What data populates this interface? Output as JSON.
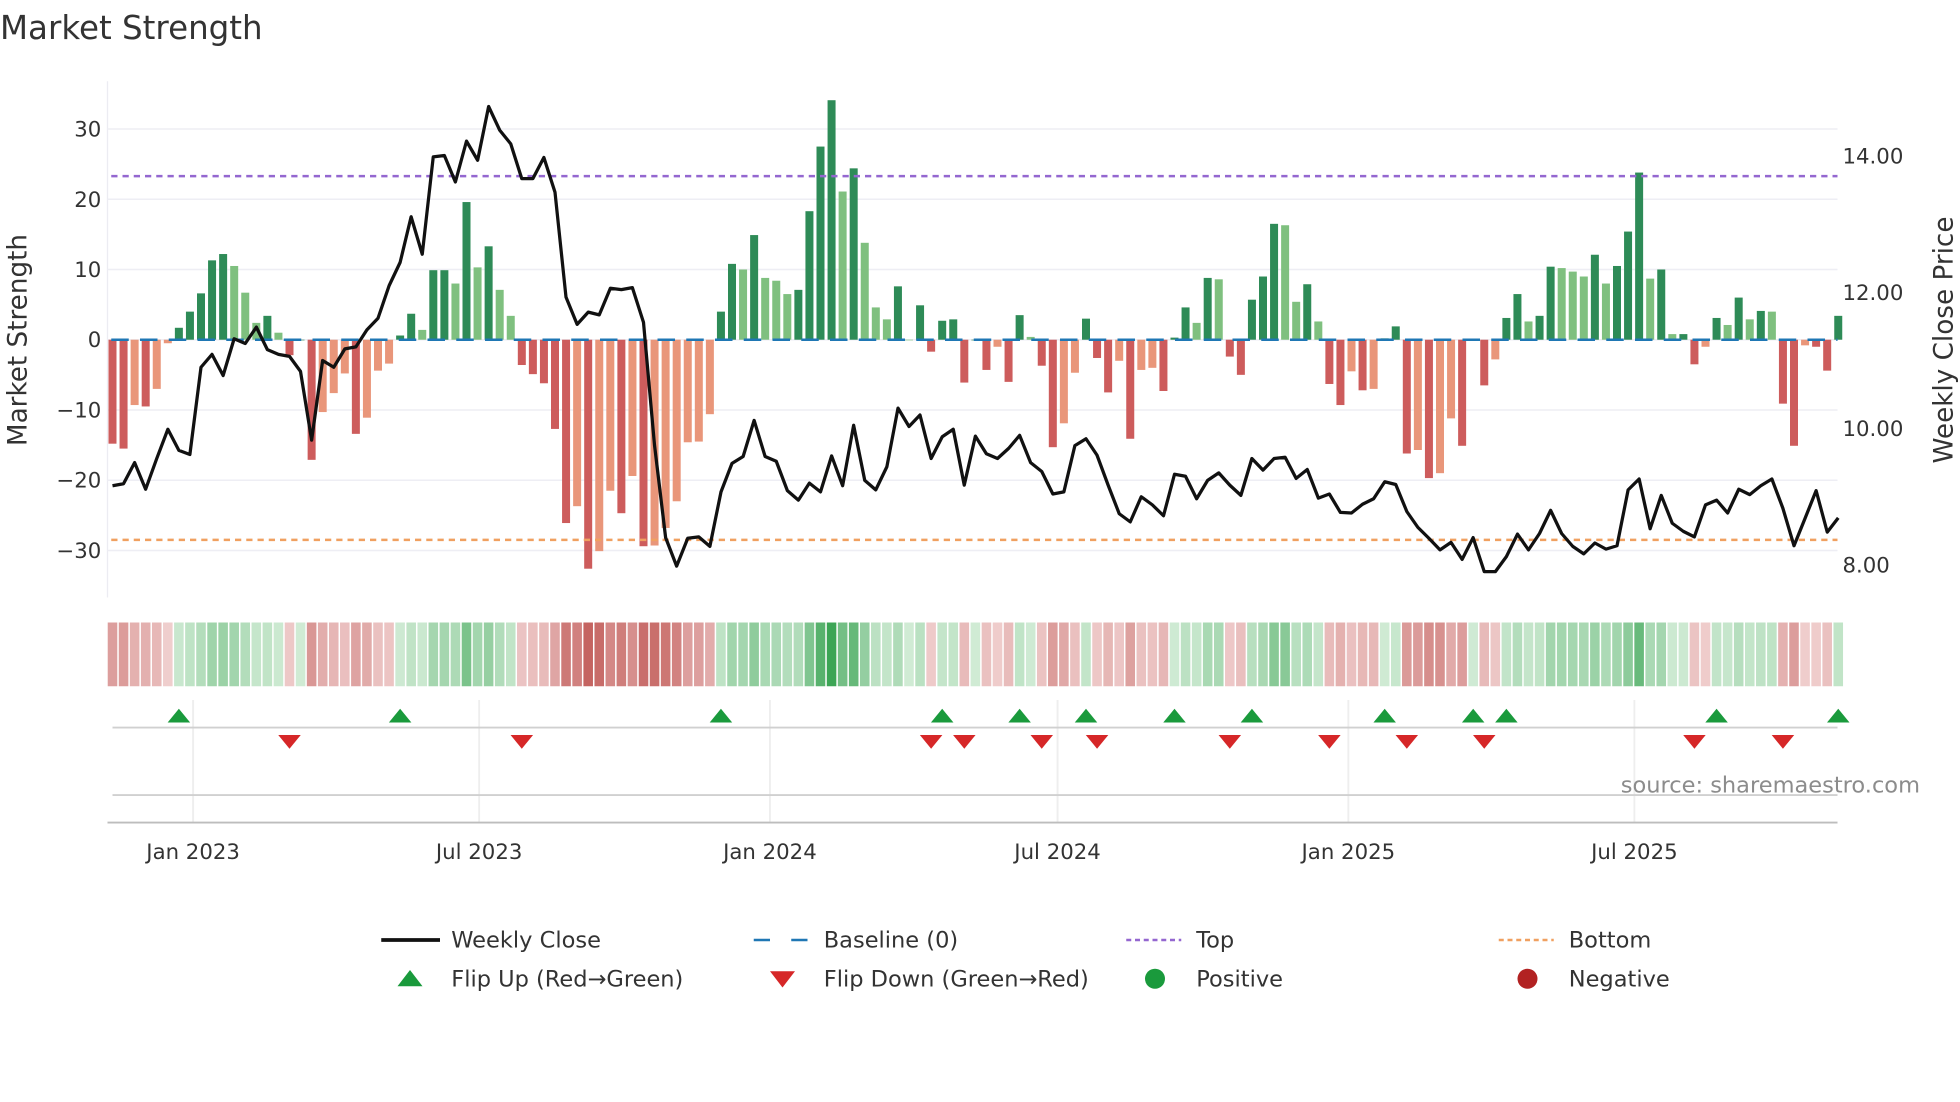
{
  "title": "Market Strength",
  "source": "source: sharemaestro.com",
  "colors": {
    "pos_strong": "#2e8b57",
    "pos_weak": "#7fc07f",
    "neg_strong": "#cd5c5c",
    "neg_weak": "#e9967a",
    "baseline": "#1f77b4",
    "top": "#9467d0",
    "bottom": "#f0a060",
    "close": "#111111",
    "flip_up": "#1a9a3c",
    "flip_down": "#d62728",
    "positive": "#1a9a3c",
    "negative": "#b22222"
  },
  "legend": [
    {
      "label": "Weekly Close",
      "icon": "line"
    },
    {
      "label": "Baseline (0)",
      "icon": "dash-line"
    },
    {
      "label": "Top",
      "icon": "dotted-line"
    },
    {
      "label": "Bottom",
      "icon": "dotted-line"
    },
    {
      "label": "Flip Up (Red→Green)",
      "icon": "triangle-up"
    },
    {
      "label": "Flip Down (Green→Red)",
      "icon": "triangle-down"
    },
    {
      "label": "Positive",
      "icon": "dot"
    },
    {
      "label": "Negative",
      "icon": "dot"
    }
  ],
  "chart_data": {
    "type": "bar",
    "title": "Market Strength",
    "ylabel": "Market Strength",
    "y2label": "Weekly Close Price",
    "ylim": [
      -36.7,
      36.8
    ],
    "y2lim": [
      7.52,
      15.1
    ],
    "yticks": [
      30,
      20,
      10,
      0,
      -10,
      -20,
      -30
    ],
    "ytick_labels": [
      "30",
      "20",
      "10",
      "0",
      "−10",
      "−20",
      "−30"
    ],
    "y2ticks": [
      14,
      12,
      10,
      8
    ],
    "y2tick_labels": [
      "14.00",
      "12.00",
      "10.00",
      "8.00"
    ],
    "xticks": [
      "2023-01-01",
      "2023-07-01",
      "2024-01-01",
      "2024-07-01",
      "2025-01-01",
      "2025-07-01"
    ],
    "xtick_labels": [
      "Jan 2023",
      "Jul 2023",
      "Jan 2024",
      "Jul 2024",
      "Jan 2025",
      "Jul 2025"
    ],
    "start_date": "2022-11-11",
    "frequency": "weekly",
    "top_level": 23.3,
    "bottom_level": -28.5,
    "grid": true,
    "legend_position": "bottom",
    "strength": [
      -14.8,
      -15.5,
      -9.3,
      -9.5,
      -7,
      -0.5,
      1.7,
      4,
      6.6,
      11.3,
      12.2,
      10.5,
      6.7,
      2.4,
      3.4,
      1,
      -2.2,
      0,
      -17.1,
      -10.3,
      -7.6,
      -4.8,
      -13.4,
      -11.1,
      -4.4,
      -3.4,
      0.6,
      3.7,
      1.4,
      9.9,
      9.9,
      8,
      19.6,
      10.3,
      13.3,
      7.1,
      3.4,
      -3.6,
      -4.9,
      -6.2,
      -12.7,
      -26.1,
      -23.7,
      -32.6,
      -30.1,
      -21.5,
      -24.7,
      -19.4,
      -29.4,
      -29.3,
      -26.8,
      -23,
      -14.6,
      -14.5,
      -10.6,
      4,
      10.8,
      10,
      14.9,
      8.8,
      8.4,
      6.5,
      7.1,
      18.3,
      27.5,
      34.1,
      21.1,
      24.4,
      13.8,
      4.6,
      2.9,
      7.6,
      0,
      4.9,
      -1.7,
      2.7,
      2.9,
      -6.1,
      0,
      -4.3,
      -1,
      -6,
      3.5,
      0.4,
      -3.7,
      -15.3,
      -11.9,
      -4.7,
      3,
      -2.6,
      -7.5,
      -3,
      -14.1,
      -4.3,
      -4,
      -7.3,
      0.3,
      4.6,
      2.4,
      8.8,
      8.6,
      -2.4,
      -5,
      5.7,
      9,
      16.5,
      16.3,
      5.4,
      7.9,
      2.6,
      -6.3,
      -9.3,
      -4.5,
      -7.2,
      -7,
      0.2,
      1.9,
      -16.2,
      -15.7,
      -19.7,
      -19,
      -11.2,
      -15.1,
      0.1,
      -6.5,
      -2.8,
      3.1,
      6.5,
      2.6,
      3.4,
      10.4,
      10.2,
      9.7,
      9,
      12.1,
      8,
      10.5,
      15.4,
      23.8,
      8.7,
      10,
      0.8,
      0.8,
      -3.5,
      -1,
      3.1,
      2.1,
      6,
      2.9,
      4.1,
      4,
      -9.1,
      -15.1,
      -0.8,
      -1,
      -4.4,
      3.4
    ],
    "close": [
      9.16,
      9.19,
      9.5,
      9.11,
      9.56,
      9.99,
      9.68,
      9.62,
      10.9,
      11.09,
      10.78,
      11.32,
      11.25,
      11.49,
      11.16,
      11.09,
      11.06,
      10.84,
      9.83,
      11.0,
      10.9,
      11.17,
      11.2,
      11.45,
      11.62,
      12.1,
      12.44,
      13.11,
      12.56,
      13.99,
      14.01,
      13.62,
      14.22,
      13.94,
      14.73,
      14.38,
      14.18,
      13.67,
      13.67,
      13.98,
      13.47,
      11.93,
      11.53,
      11.71,
      11.67,
      12.06,
      12.04,
      12.07,
      11.56,
      9.76,
      8.4,
      7.98,
      8.39,
      8.41,
      8.27,
      9.07,
      9.49,
      9.59,
      10.12,
      9.59,
      9.52,
      9.09,
      8.95,
      9.2,
      9.07,
      9.6,
      9.16,
      10.05,
      9.24,
      9.1,
      9.44,
      10.3,
      10.03,
      10.2,
      9.56,
      9.88,
      9.99,
      9.17,
      9.89,
      9.63,
      9.56,
      9.71,
      9.9,
      9.5,
      9.37,
      9.04,
      9.07,
      9.75,
      9.85,
      9.61,
      9.17,
      8.75,
      8.63,
      9.0,
      8.88,
      8.72,
      9.33,
      9.3,
      8.97,
      9.24,
      9.35,
      9.17,
      9.02,
      9.56,
      9.39,
      9.56,
      9.58,
      9.27,
      9.4,
      8.98,
      9.04,
      8.77,
      8.76,
      8.89,
      8.97,
      9.22,
      9.18,
      8.78,
      8.55,
      8.39,
      8.22,
      8.33,
      8.08,
      8.4,
      7.9,
      7.9,
      8.12,
      8.45,
      8.22,
      8.46,
      8.8,
      8.46,
      8.27,
      8.16,
      8.32,
      8.23,
      8.28,
      9.1,
      9.26,
      8.53,
      9.02,
      8.61,
      8.49,
      8.41,
      8.88,
      8.95,
      8.76,
      9.11,
      9.03,
      9.16,
      9.26,
      8.83,
      8.28,
      8.68,
      9.09,
      8.48,
      8.69
    ],
    "flip_up_weeks": [
      6,
      26,
      55,
      75,
      82,
      88,
      96,
      103,
      115,
      123,
      126,
      145,
      156
    ],
    "flip_down_weeks": [
      16,
      37,
      74,
      77,
      84,
      89,
      101,
      110,
      117,
      124,
      143,
      151
    ]
  }
}
